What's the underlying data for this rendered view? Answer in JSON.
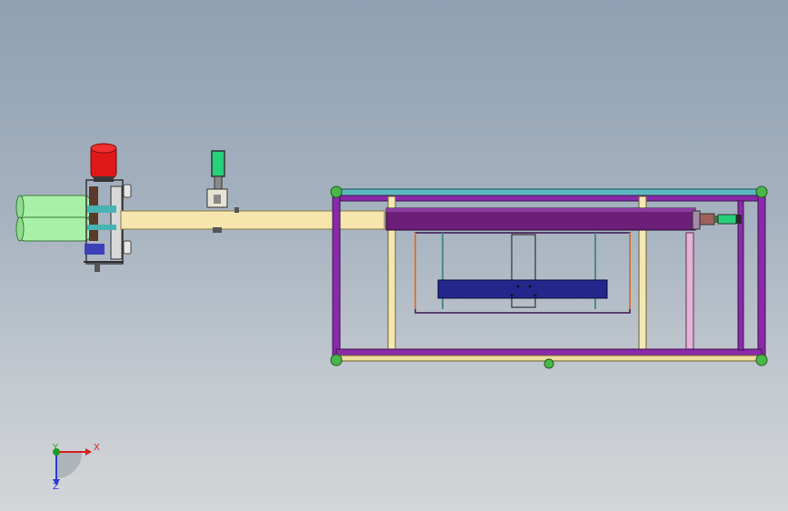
{
  "viewport": {
    "background_top": "#8fa0b3",
    "background_bottom": "#d3d6d8"
  },
  "model": {
    "parts": [
      "feed-barrel-upper",
      "feed-barrel-lower",
      "drive-motor",
      "gearbox-bracket",
      "feed-beam",
      "valve-actuator",
      "frame",
      "cross-beam",
      "platen",
      "side-cylinder"
    ],
    "colors": {
      "barrel": "#a8f0a8",
      "motor": "#e01818",
      "beam": "#f6e6ae",
      "frame_top": "#5cb8c0",
      "frame_purple": "#8a2aa8",
      "cross_beam": "#6b1f78",
      "platen": "#23268a",
      "frame_post": "#eddc9b",
      "corner_foot": "#49b849",
      "actuator_green": "#27d07a",
      "cylinder_brown": "#a0605c"
    }
  },
  "triad": {
    "x_label": "X",
    "y_label": "Y",
    "z_label": "Z",
    "x_color": "#d42020",
    "y_color": "#1f9a1f",
    "z_color": "#2b3ad8"
  }
}
